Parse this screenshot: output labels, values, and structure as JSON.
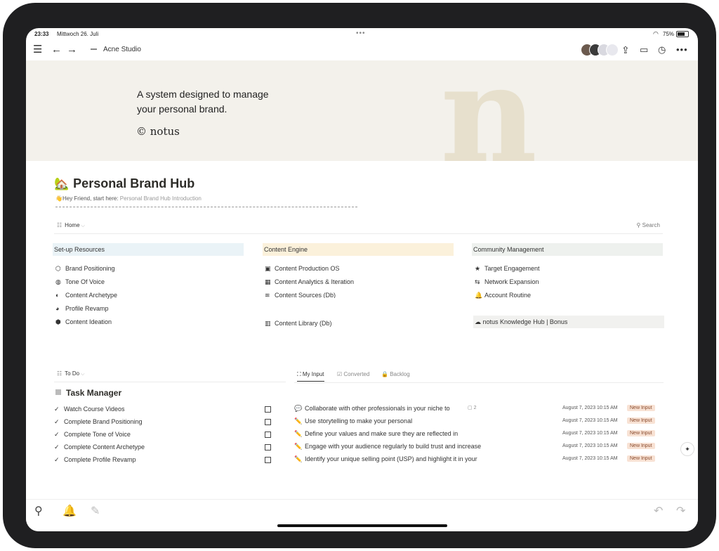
{
  "status": {
    "time": "23:33",
    "date": "Mittwoch 26. Juli",
    "more": "•••",
    "battery": "75%"
  },
  "toolbar": {
    "breadcrumb": "Acne Studio"
  },
  "banner": {
    "line1": "A system designed to manage",
    "line2": "your personal brand.",
    "logo": "© notus",
    "big_letter": "n"
  },
  "page": {
    "title": "Personal Brand Hub",
    "subtitle_prefix": "👋Hey Friend, start here:",
    "subtitle_link": "Personal Brand Hub Introduction"
  },
  "view": {
    "name": "Home",
    "search": "Search"
  },
  "columns": [
    {
      "heading": "Set-up Resources",
      "color": "#eaf3f7",
      "items": [
        "Brand Positioning",
        "Tone Of Voice",
        "Content Archetype",
        "Profile Revamp",
        "Content Ideation"
      ],
      "icons": [
        "⬡",
        "◍",
        "◐",
        "◕",
        "⬢"
      ]
    },
    {
      "heading": "Content Engine",
      "color": "#fbf1db",
      "items": [
        "Content Production OS",
        "Content Analytics & Iteration",
        "Content Sources (Db)",
        "Content Library (Db)"
      ],
      "icons": [
        "▣",
        "▦",
        "≋",
        "▥"
      ]
    },
    {
      "heading": "Community Management",
      "color": "#eef1ee",
      "items": [
        "Target Engagement",
        "Network Expansion",
        "Account Routine"
      ],
      "icons": [
        "★",
        "⇆",
        "🔔"
      ],
      "bonus": "notus Knowledge Hub | Bonus"
    }
  ],
  "todo": {
    "view": "To Do",
    "title": "Task Manager"
  },
  "tasks": [
    "Watch Course Videos",
    "Complete Brand Positioning",
    "Complete Tone of Voice",
    "Complete Content Archetype",
    "Complete Profile Revamp"
  ],
  "tabs": [
    "My Input",
    "Converted",
    "Backlog"
  ],
  "inputs": [
    {
      "icon": "💬",
      "text": "Collaborate with other professionals in your niche to",
      "comments": "2",
      "date": "August 7, 2023 10:15 AM",
      "badge": "New Input"
    },
    {
      "icon": "✏️",
      "text": "Use storytelling to make your personal",
      "comments": "",
      "date": "August 7, 2023 10:15 AM",
      "badge": "New Input"
    },
    {
      "icon": "✏️",
      "text": "Define your values and make sure they are reflected in",
      "comments": "",
      "date": "August 7, 2023 10:15 AM",
      "badge": "New Input"
    },
    {
      "icon": "✏️",
      "text": "Engage with your audience regularly to build trust and increase",
      "comments": "",
      "date": "August 7, 2023 10:15 AM",
      "badge": "New Input"
    },
    {
      "icon": "✏️",
      "text": "Identify your unique selling point (USP) and highlight it in your",
      "comments": "",
      "date": "August 7, 2023 10:15 AM",
      "badge": "New Input"
    }
  ],
  "colors": {
    "badge_bg": "#f8e2d4",
    "banner_bg": "#f3f1eb",
    "banner_letter": "#e7e0cd"
  }
}
